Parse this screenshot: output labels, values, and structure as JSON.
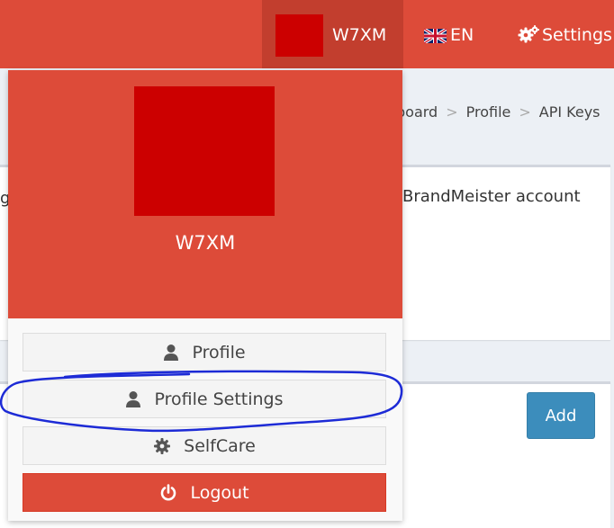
{
  "navbar": {
    "username": "W7XM",
    "language": "EN",
    "settings_label": "Settings"
  },
  "breadcrumb": {
    "items": [
      "board",
      "Profile",
      "API Keys"
    ]
  },
  "content": {
    "box1_text": "BrandMeister account",
    "box1_left_fragment": "g",
    "add_label": "Add"
  },
  "dropdown": {
    "user_name": "W7XM",
    "buttons": {
      "profile": "Profile",
      "profile_settings": "Profile Settings",
      "selfcare": "SelfCare",
      "logout": "Logout"
    }
  },
  "colors": {
    "brand": "#dd4b39",
    "avatar": "#cc0000",
    "primary": "#3c8dbc",
    "annotation": "#1d2bd6"
  },
  "icons": {
    "language": "uk-flag-icon",
    "settings": "gears-icon",
    "profile": "user-icon",
    "selfcare": "gear-icon",
    "logout": "power-icon"
  }
}
